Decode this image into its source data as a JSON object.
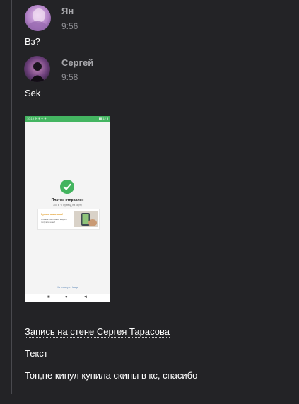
{
  "messages": [
    {
      "author": "Ян",
      "time": "9:56",
      "text": "Вз?"
    },
    {
      "author": "Сергей",
      "time": "9:58",
      "text": "Sek"
    }
  ],
  "attachment": {
    "status_left": "10:19 ✈ ✈ ✈ ✈",
    "status_right": "▮▮ 12 ▮",
    "title": "Платеж отправлен",
    "subtitle": "300 ₽ · Перевод на карту",
    "card_title": "Купить выигрыш!",
    "card_text": "Станьте участником акции и получите шанс!",
    "bottom_link": "На главную Назад",
    "nav_square": "■",
    "nav_circle": "●",
    "nav_back": "◄"
  },
  "wall_post": {
    "link_label": "Запись на стене Сергея Тарасова",
    "text": "Текст",
    "body": "Топ,не кинул купила скины в кс, спасибо"
  }
}
